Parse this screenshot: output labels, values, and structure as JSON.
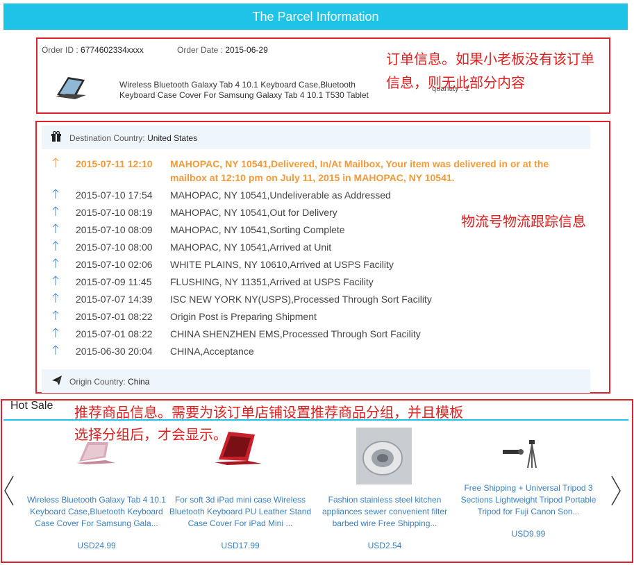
{
  "header": {
    "title": "The Parcel Information"
  },
  "order": {
    "id_label": "Order ID : ",
    "id_value": "6774602334xxxx",
    "date_label": "Order Date : ",
    "date_value": "2015-06-29",
    "product_line1": "Wireless Bluetooth Galaxy Tab 4 10.1 Keyboard Case,Bluetooth",
    "product_line2": "Keyboard Case Cover For Samsung Galaxy Tab 4 10.1 T530 Tablet",
    "quantity": "quantity : 1",
    "annotation_line1": "订单信息。如果小老板没有该订单",
    "annotation_line2": "信息，则无此部分内容"
  },
  "tracking": {
    "destination_label": "Destination Country: ",
    "destination_value": "United States",
    "origin_label": "Origin Country: ",
    "origin_value": "China",
    "annotation": "物流号物流跟踪信息",
    "events": [
      {
        "time": "2015-07-11 12:10",
        "desc": "MAHOPAC, NY 10541,Delivered, In/At Mailbox, Your item was delivered in or at the mailbox at 12:10 pm on July 11, 2015 in MAHOPAC, NY 10541."
      },
      {
        "time": "2015-07-10 17:54",
        "desc": "MAHOPAC, NY 10541,Undeliverable as Addressed"
      },
      {
        "time": "2015-07-10 08:19",
        "desc": "MAHOPAC, NY 10541,Out for Delivery"
      },
      {
        "time": "2015-07-10 08:09",
        "desc": "MAHOPAC, NY 10541,Sorting Complete"
      },
      {
        "time": "2015-07-10 08:00",
        "desc": "MAHOPAC, NY 10541,Arrived at Unit"
      },
      {
        "time": "2015-07-10 02:06",
        "desc": "WHITE PLAINS, NY 10610,Arrived at USPS Facility"
      },
      {
        "time": "2015-07-09 11:45",
        "desc": "FLUSHING, NY 11351,Arrived at USPS Facility"
      },
      {
        "time": "2015-07-07 14:39",
        "desc": "ISC NEW YORK NY(USPS),Processed Through Sort Facility"
      },
      {
        "time": "2015-07-01 08:22",
        "desc": "Origin Post is Preparing Shipment"
      },
      {
        "time": "2015-07-01 08:22",
        "desc": "CHINA SHENZHEN EMS,Processed Through Sort Facility"
      },
      {
        "time": "2015-06-30 20:04",
        "desc": "CHINA,Acceptance"
      }
    ]
  },
  "hot_sale": {
    "title": "Hot Sale",
    "annotation_line1": "推荐商品信息。需要为该订单店铺设置推荐商品分组，并且模板",
    "annotation_line2": "选择分组后，才会显示。",
    "products": [
      {
        "name": "Wireless Bluetooth Galaxy Tab 4 10.1 Keyboard Case,Bluetooth Keyboard Case Cover For Samsung Gala...",
        "price": "USD24.99"
      },
      {
        "name": "For soft 3d iPad mini case Wireless Bluetooth Keyboard PU Leather Stand Case Cover For iPad Mini ...",
        "price": "USD17.99"
      },
      {
        "name": "Fashion stainless steel kitchen appliances sewer convenient filter barbed wire Free Shipping...",
        "price": "USD2.54"
      },
      {
        "name": "Free Shipping + Universal Tripod 3 Sections Lightweight Tripod Portable Tripod for Fuji Canon Son...",
        "price": "USD9.99"
      }
    ]
  }
}
